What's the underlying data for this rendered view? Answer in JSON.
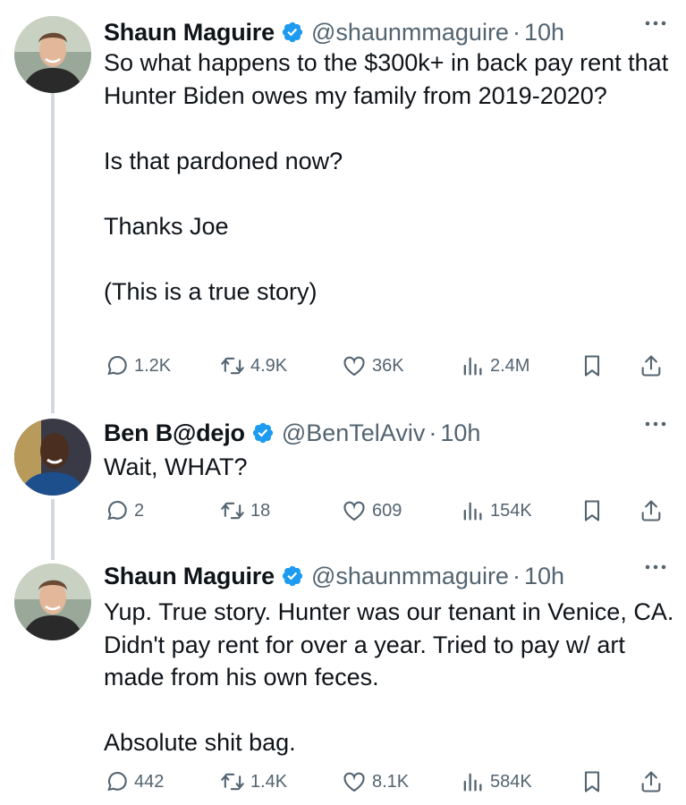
{
  "tweets": [
    {
      "name": "Shaun Maguire",
      "handle": "@shaunmmaguire",
      "sep": "·",
      "time": "10h",
      "text": "So what happens to the $300k+ in back pay rent that Hunter Biden owes my family from 2019-2020?\n\nIs that pardoned now?\n\nThanks Joe\n\n(This is a true story)",
      "replies": "1.2K",
      "reposts": "4.9K",
      "likes": "36K",
      "views": "2.4M"
    },
    {
      "name": "Ben B@dejo",
      "handle": "@BenTelAviv",
      "sep": "·",
      "time": "10h",
      "text": "Wait, WHAT?",
      "replies": "2",
      "reposts": "18",
      "likes": "609",
      "views": "154K"
    },
    {
      "name": "Shaun Maguire",
      "handle": "@shaunmmaguire",
      "sep": "·",
      "time": "10h",
      "text": "Yup. True story. Hunter was our tenant in Venice, CA. Didn't pay rent for over a year. Tried to pay w/ art made from his own feces.\n\nAbsolute shit bag.",
      "replies": "442",
      "reposts": "1.4K",
      "likes": "8.1K",
      "views": "584K"
    }
  ],
  "icons": {
    "verified": "verified-badge-icon",
    "more": "more-dots-icon",
    "reply": "reply-bubble-icon",
    "repost": "repost-arrows-icon",
    "like": "heart-icon",
    "views": "views-bars-icon",
    "bookmark": "bookmark-icon",
    "share": "share-upload-icon"
  },
  "colors": {
    "verified": "#1d9bf0",
    "secondary_text": "#536471",
    "thread_line": "#cfd9de"
  }
}
